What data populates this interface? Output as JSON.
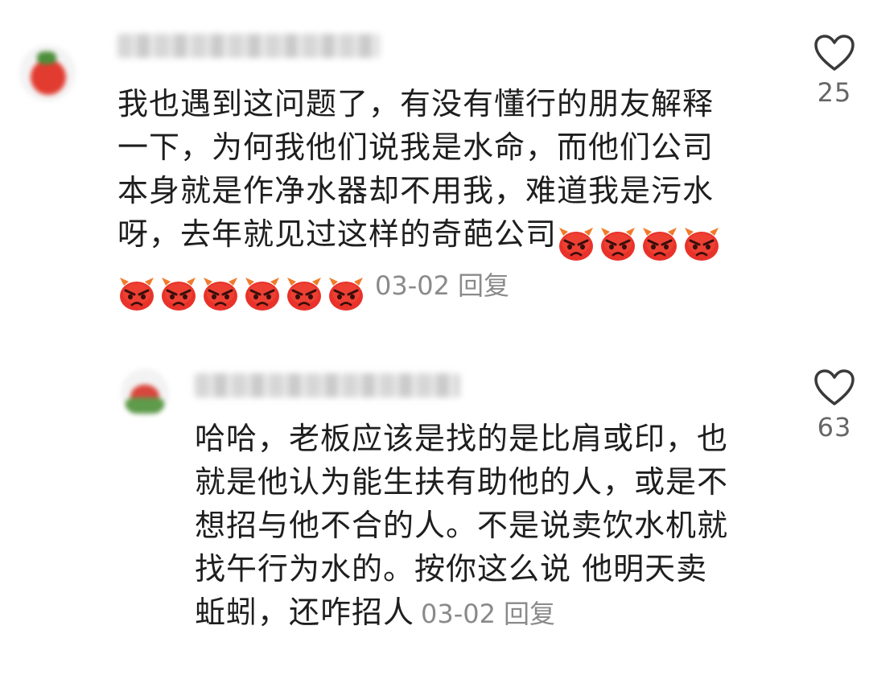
{
  "comments": [
    {
      "lines": [
        "我也遇到这问题了，有没有懂行的朋友解释",
        "一下，为何我他们说我是水命，而他们公司",
        "本身就是作净水器却不用我，难道我是污水",
        "呀，去年就见过这样的奇葩公司"
      ],
      "emoji_icon": "angry-devil-emoji",
      "emoji_count_line4": 4,
      "emoji_count_line5": 6,
      "date": "03-02",
      "reply_label": "回复",
      "like_count": "25"
    },
    {
      "lines": [
        "哈哈，老板应该是找的是比肩或印，也",
        "就是他认为能生扶有助他的人，或是不",
        "想招与他不合的人。不是说卖饮水机就",
        "找午行为水的。按你这么说 他明天卖",
        "蚯蚓，还咋招人"
      ],
      "date": "03-02",
      "reply_label": "回复",
      "like_count": "63"
    }
  ],
  "colors": {
    "text": "#1e1e1e",
    "meta": "#8a8a8a",
    "emoji_red": "#e8322a"
  },
  "icons": {
    "like": "heart-outline-icon"
  }
}
